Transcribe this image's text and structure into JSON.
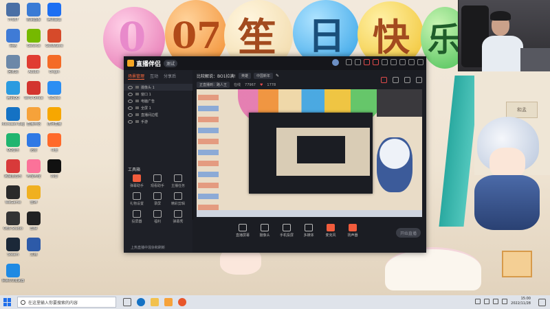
{
  "desktop": {
    "balloon_text": [
      "0",
      "07",
      "笙",
      "日",
      "快",
      "乐"
    ],
    "card_text": "和孟",
    "icons_col1": [
      {
        "label": "7F667",
        "color": "#4a6fa5"
      },
      {
        "label": "网络",
        "color": "#3f7bd6"
      },
      {
        "label": "回收站",
        "color": "#6c88a8"
      },
      {
        "label": "腾讯QQ",
        "color": "#2b9be0"
      },
      {
        "label": "Microsoft Edge",
        "color": "#1572c4"
      },
      {
        "label": "QQ音乐",
        "color": "#20b56f"
      },
      {
        "label": "网易云音乐",
        "color": "#d83a3a"
      },
      {
        "label": "WeGame",
        "color": "#2a2a2a"
      },
      {
        "label": "OBS Studio",
        "color": "#333"
      },
      {
        "label": "Steam",
        "color": "#1b2838"
      },
      {
        "label": "网易UU加速器",
        "color": "#1f8ae3"
      }
    ],
    "icons_col2": [
      {
        "label": "控制面板",
        "color": "#3a7bd5"
      },
      {
        "label": "Geforce",
        "color": "#76b900"
      },
      {
        "label": "Adobe",
        "color": "#e03c31"
      },
      {
        "label": "WPS Office",
        "color": "#d3342f"
      },
      {
        "label": "直播伴侣",
        "color": "#f6a23a"
      },
      {
        "label": "迅雷",
        "color": "#2f79e5"
      },
      {
        "label": "哔哩哔哩",
        "color": "#fb7299"
      },
      {
        "label": "雷神",
        "color": "#f0b020"
      },
      {
        "label": "剪映",
        "color": "#222"
      },
      {
        "label": "文档",
        "color": "#2d5aa8"
      }
    ],
    "icons_col3": [
      {
        "label": "腾讯会议",
        "color": "#1d6ff2"
      },
      {
        "label": "GoldWave",
        "color": "#d64a2a"
      },
      {
        "label": "Origin",
        "color": "#f46b26"
      },
      {
        "label": "ToDesk",
        "color": "#2b8ef3"
      },
      {
        "label": "虎牙直播",
        "color": "#f7a700"
      },
      {
        "label": "斗鱼",
        "color": "#ff6a2a"
      },
      {
        "label": "抖音",
        "color": "#111"
      }
    ]
  },
  "app": {
    "name": "直播伴侣",
    "version": "测试",
    "tabs": [
      "场景管理",
      "互动",
      "分享后"
    ],
    "scenes": [
      "摄像头 1",
      "窗口 1",
      "电脑广告",
      "全屏 1",
      "直播间边框",
      "手游"
    ],
    "stream_title": "比较解说：BO1拉满!",
    "pill_1": "英雄",
    "pill_2": "中国新年",
    "status_text": "正直播到：路人王",
    "stat_1": "在线",
    "stat_1_value": "77967",
    "stat_2_value": "1778",
    "tools_header": "工具箱",
    "tools": [
      "弹幕助手",
      "观看助手",
      "主播任务",
      "礼物设置",
      "录屏",
      "精彩剪辑",
      "投屏器",
      "福利",
      "弹幕秀",
      "直播间",
      "模板库",
      "更多"
    ],
    "tip": "上热直播中混杂和刷新",
    "bottom": [
      "直播屏幕",
      "摄像头",
      "手机投屏",
      "多媒体",
      "麦克风",
      "扬声器"
    ],
    "go_live": "开始直播"
  },
  "taskbar": {
    "search_placeholder": "在这里输入你要搜索的内容",
    "time": "15:00",
    "date": "2022/11/28"
  }
}
